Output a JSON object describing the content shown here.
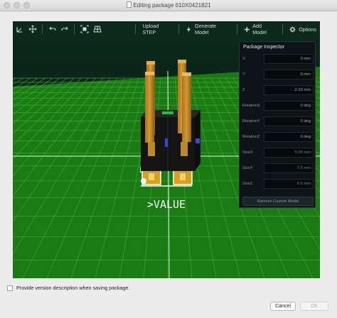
{
  "window": {
    "title": "Editing package 610X0421821"
  },
  "toolbar": {
    "upload_step": "Upload STEP",
    "generate_model": "Generate Model",
    "add_model": "Add Model",
    "options": "Options"
  },
  "viewport": {
    "silkscreen_value": ">VALUE"
  },
  "inspector": {
    "title": "Package Inspector",
    "fields": [
      {
        "label": "X",
        "value": "0 mm"
      },
      {
        "label": "Y",
        "value": "0 mm"
      },
      {
        "label": "Z",
        "value": "2.33 mm"
      },
      {
        "label": "RotationX",
        "value": "0 deg"
      },
      {
        "label": "RotationY",
        "value": "0 deg"
      },
      {
        "label": "RotationZ",
        "value": "0 deg"
      },
      {
        "label": "SizeX",
        "value": "5.08 mm"
      },
      {
        "label": "SizeY",
        "value": "7.5 mm"
      },
      {
        "label": "SizeZ",
        "value": "9.6 mm"
      }
    ],
    "remove_button": "Remove Custom Model"
  },
  "footer": {
    "version_checkbox_label": "Provide version description when saving package.",
    "cancel": "Cancel",
    "ok": "OK"
  }
}
